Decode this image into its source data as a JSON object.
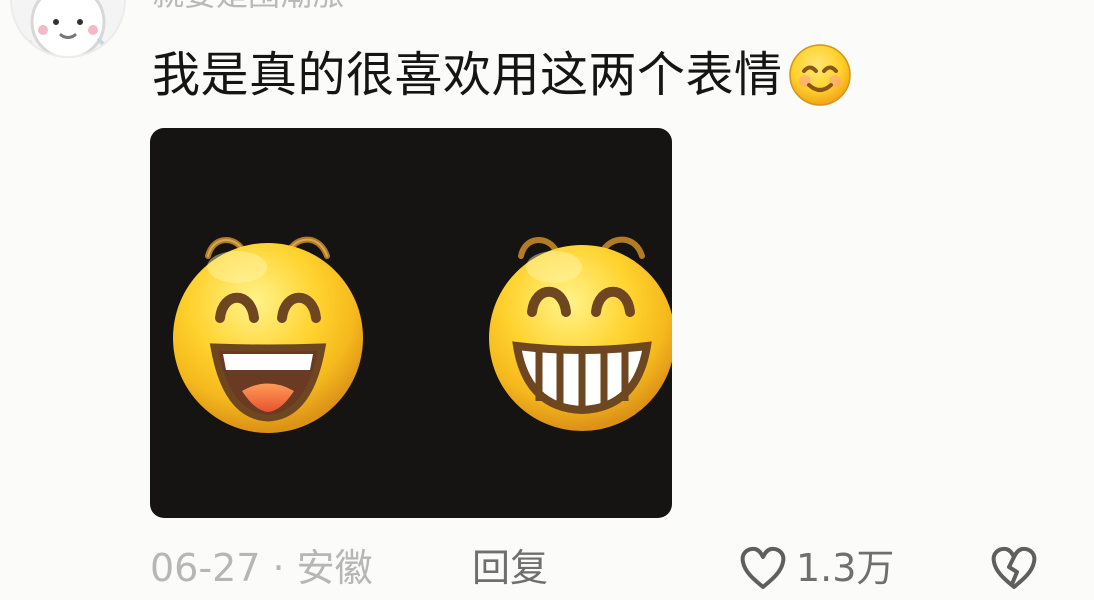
{
  "comment": {
    "username": "就要是围潮涨",
    "text": "我是真的很喜欢用这两个表情",
    "inline_emoji": "smiling-face-emoji",
    "image": {
      "left_emoji": "laughing-face-emoji",
      "right_emoji": "grinning-teeth-face-emoji",
      "background": "#161313"
    },
    "meta": {
      "date_location": "06-27 · 安徽",
      "reply_label": "回复",
      "like_count": "1.3万"
    }
  },
  "colors": {
    "page_background": "#fbfbf9",
    "primary_text": "#151515",
    "secondary_text": "#b6b6b6",
    "action_text": "#6f6f6f",
    "emoji_yellow": "#ffd12a",
    "emoji_outline": "#b37b23"
  }
}
